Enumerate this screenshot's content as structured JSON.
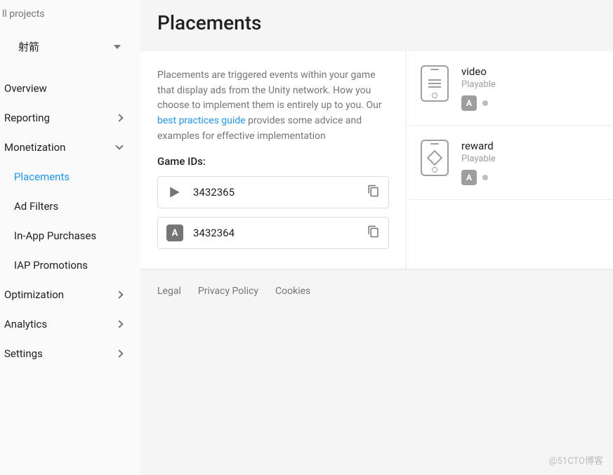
{
  "sidebar": {
    "all_projects": "ll projects",
    "project_name": "射箭",
    "nav": {
      "overview": "Overview",
      "reporting": "Reporting",
      "monetization": "Monetization",
      "sub_placements": "Placements",
      "sub_ad_filters": "Ad Filters",
      "sub_iap_purchases": "In-App Purchases",
      "sub_iap_promotions": "IAP Promotions",
      "optimization": "Optimization",
      "analytics": "Analytics",
      "settings": "Settings"
    }
  },
  "page": {
    "title": "Placements",
    "info_text_1": "Placements are triggered events within your game that display ads from the Unity network. How you choose to implement them is entirely up to you. Our ",
    "info_link": "best practices guide",
    "info_text_2": " provides some advice and examples for effective implementation",
    "game_ids_label": "Game IDs:",
    "game_ids": [
      {
        "platform": "google-play",
        "value": "3432365"
      },
      {
        "platform": "app-store",
        "value": "3432364"
      }
    ],
    "placements": [
      {
        "name": "video",
        "subtitle": "Playable"
      },
      {
        "name": "reward",
        "subtitle": "Playable"
      }
    ]
  },
  "footer": {
    "legal": "Legal",
    "privacy": "Privacy Policy",
    "cookies": "Cookies"
  },
  "watermark": "@51CTO博客"
}
